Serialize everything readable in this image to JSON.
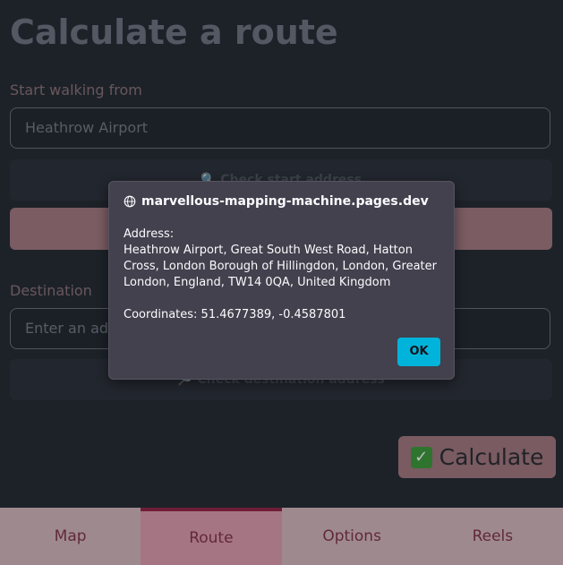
{
  "page": {
    "title": "Calculate a route",
    "start_label": "Start walking from",
    "start_value": "Heathrow Airport",
    "check_start_label": "🔍 Check start address",
    "destination_label": "Destination",
    "destination_placeholder": "Enter an address",
    "check_destination_label": "🔎 Check destination address",
    "calculate_label": "Calculate"
  },
  "tabs": [
    {
      "label": "Map"
    },
    {
      "label": "Route"
    },
    {
      "label": "Options"
    },
    {
      "label": "Reels"
    }
  ],
  "dialog": {
    "origin": "marvellous-mapping-machine.pages.dev",
    "message": "Address:\nHeathrow Airport, Great South West Road, Hatton Cross, London Borough of Hillingdon, London, Greater London, England, TW14 0QA, United Kingdom\n\nCoordinates: 51.4677389, -0.4587801",
    "ok_label": "OK"
  },
  "colors": {
    "accent": "#a57a82",
    "ok_button": "#00b3db",
    "active_tab": "#6e1d38"
  },
  "active_tab": "Route"
}
